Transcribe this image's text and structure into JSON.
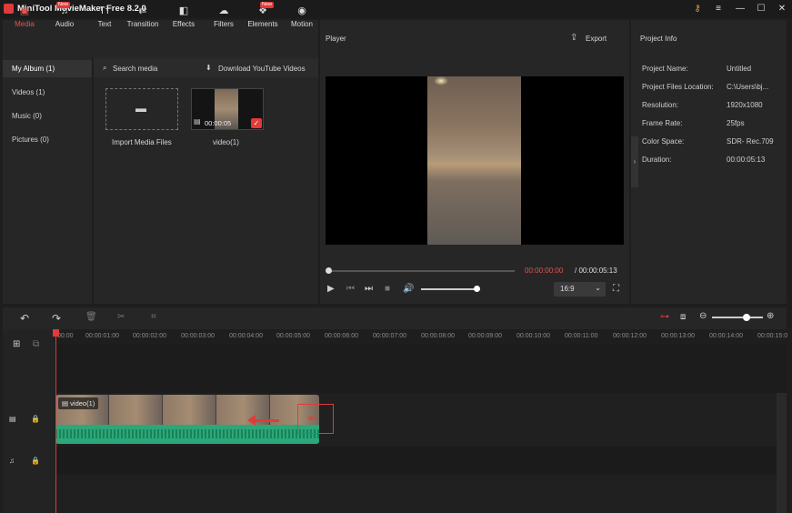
{
  "window": {
    "title": "MiniTool MovieMaker Free 8.2.0",
    "minimize": "—",
    "restore": "☐",
    "close": "✕",
    "menu": "≡",
    "key": "⚷"
  },
  "tabs": [
    {
      "label": "Media",
      "icon": "▣",
      "active": true
    },
    {
      "label": "Audio",
      "icon": "♫",
      "badge": "New"
    },
    {
      "label": "Text",
      "icon": "Tт"
    },
    {
      "label": "Transition",
      "icon": "⇄"
    },
    {
      "label": "Effects",
      "icon": "◧"
    },
    {
      "label": "Filters",
      "icon": "☁"
    },
    {
      "label": "Elements",
      "icon": "❖",
      "badge": "New"
    },
    {
      "label": "Motion",
      "icon": "◉"
    }
  ],
  "albums": [
    "My Album (1)",
    "Videos (1)",
    "Music (0)",
    "Pictures (0)"
  ],
  "media": {
    "search": "Search media",
    "download": "Download YouTube Videos",
    "import_label": "Import Media Files",
    "clip_name": "video(1)",
    "clip_duration": "00:00:05"
  },
  "player": {
    "title": "Player",
    "export": "Export",
    "current_time": "00:00:00:00",
    "total_time": "/ 00:00:05:13",
    "ratio": "16:9",
    "seek_progress": 0,
    "volume": 1
  },
  "project": {
    "title": "Project Info",
    "rows": [
      {
        "k": "Project Name:",
        "v": "Untitled"
      },
      {
        "k": "Project Files Location:",
        "v": "C:\\Users\\bj..."
      },
      {
        "k": "Resolution:",
        "v": "1920x1080"
      },
      {
        "k": "Frame Rate:",
        "v": "25fps"
      },
      {
        "k": "Color Space:",
        "v": "SDR- Rec.709"
      },
      {
        "k": "Duration:",
        "v": "00:00:05:13"
      }
    ]
  },
  "timeline": {
    "ticks": [
      "00:00",
      "00:00:01:00",
      "00:00:02:00",
      "00:00:03:00",
      "00:00:04:00",
      "00:00:05:00",
      "00:00:06:00",
      "00:00:07:00",
      "00:00:08:00",
      "00:00:09:00",
      "00:00:10:00",
      "00:00:11:00",
      "00:00:12:00",
      "00:00:13:00",
      "00:00:14:00",
      "00:00:15:0"
    ],
    "clip_label": "video(1)"
  },
  "colors": {
    "accent": "#e23a3a",
    "wave": "#2aa87a"
  }
}
